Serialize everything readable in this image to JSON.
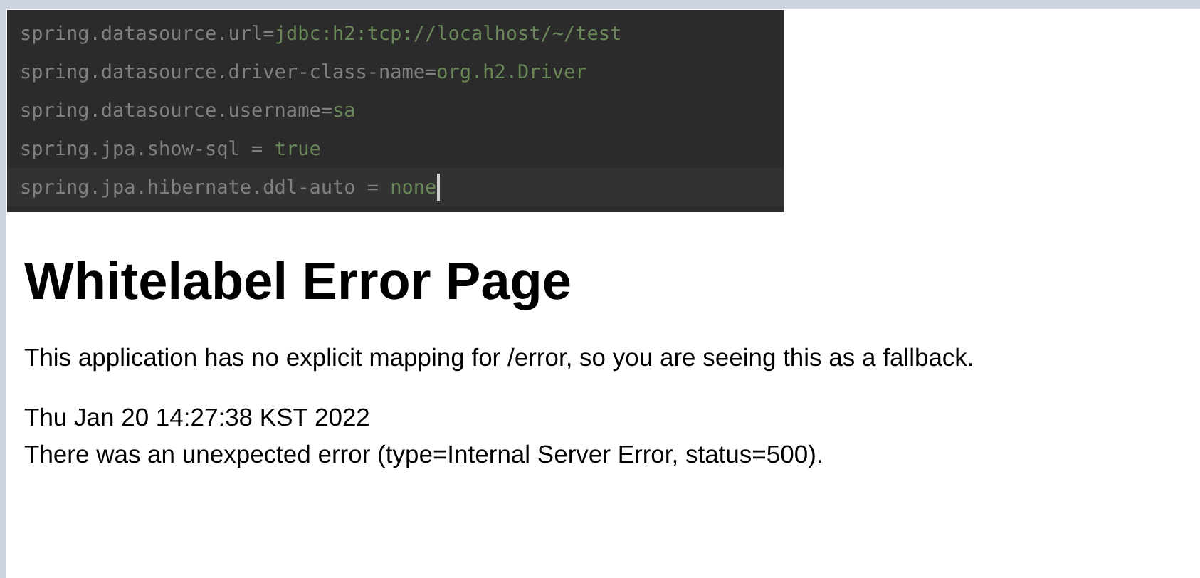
{
  "code_editor": {
    "lines": [
      {
        "key": "spring.datasource.url=",
        "value": "jdbc:h2:tcp://localhost/~/test",
        "current": false
      },
      {
        "key": "spring.datasource.driver-class-name=",
        "value": "org.h2.Driver",
        "current": false
      },
      {
        "key": "spring.datasource.username=",
        "value": "sa",
        "current": false
      },
      {
        "key": "spring.jpa.show-sql = ",
        "value": "true",
        "current": false
      },
      {
        "key": "spring.jpa.hibernate.ddl-auto = ",
        "value": "none",
        "current": true
      }
    ]
  },
  "error_page": {
    "title": "Whitelabel Error Page",
    "message": "This application has no explicit mapping for /error, so you are seeing this as a fallback.",
    "timestamp": "Thu Jan 20 14:27:38 KST 2022",
    "detail": "There was an unexpected error (type=Internal Server Error, status=500)."
  }
}
